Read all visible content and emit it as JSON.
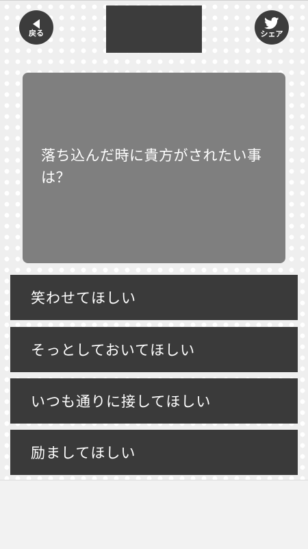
{
  "header": {
    "back_label": "戻る",
    "share_label": "シェア",
    "back_icon": "left-triangle-icon",
    "share_icon": "twitter-bird-icon"
  },
  "question": {
    "text": "落ち込んだ時に貴方がされたい事は？"
  },
  "answers": [
    {
      "label": "笑わせてほしい"
    },
    {
      "label": "そっとしておいてほしい"
    },
    {
      "label": "いつも通りに接してほしい"
    },
    {
      "label": "励ましてほしい"
    }
  ],
  "colors": {
    "dark_button": "#3a3a3a",
    "question_card": "#7f7f7f",
    "background": "#efefef",
    "text": "#ffffff"
  }
}
